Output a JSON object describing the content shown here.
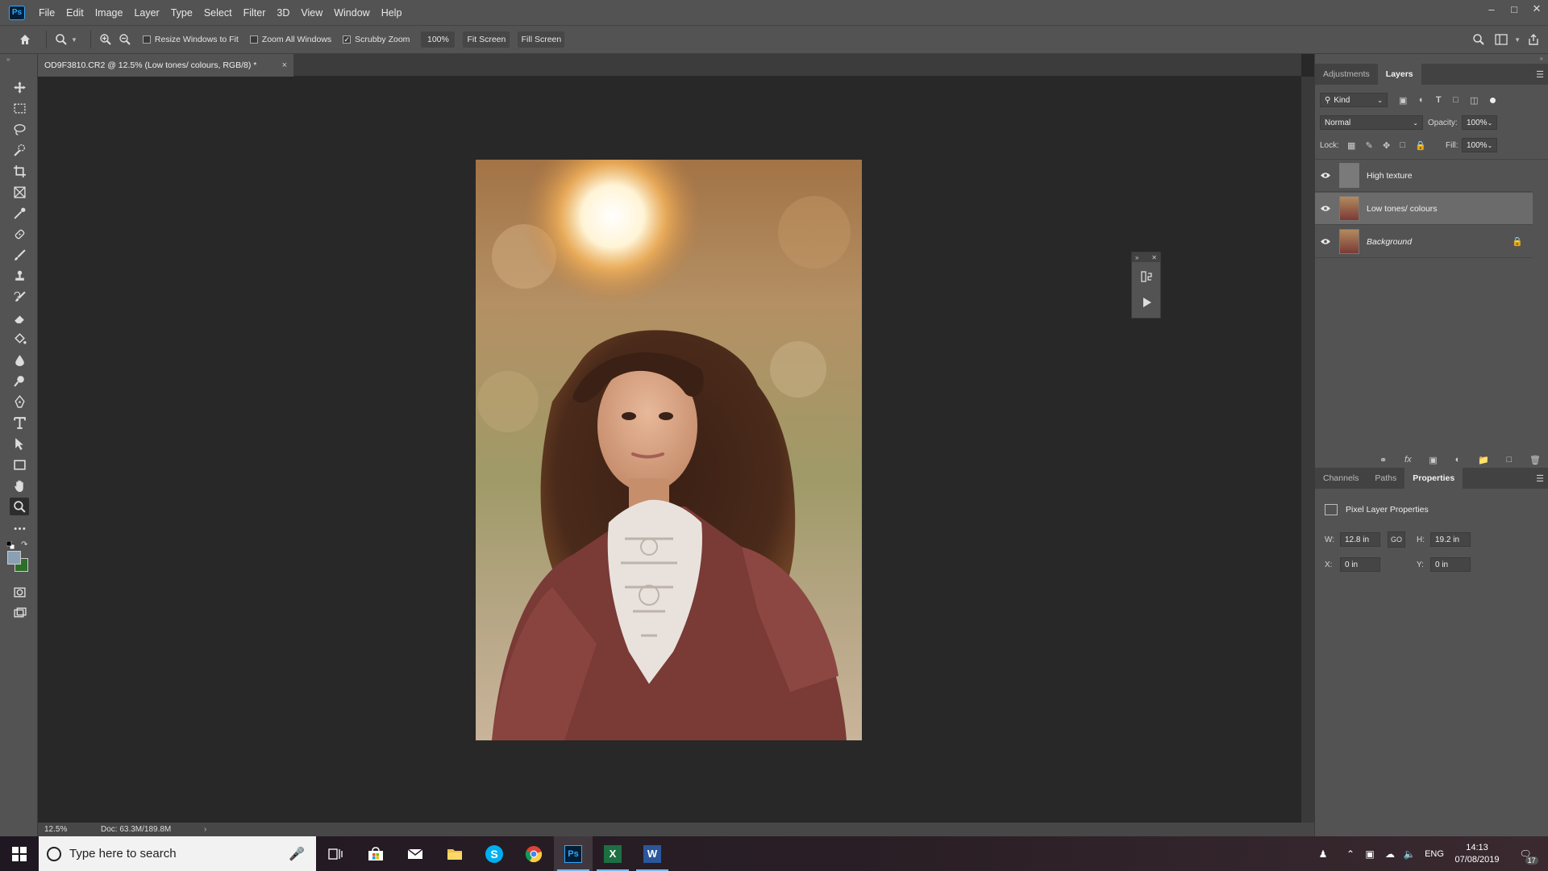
{
  "app": {
    "logo": "Ps"
  },
  "menu": [
    "File",
    "Edit",
    "Image",
    "Layer",
    "Type",
    "Select",
    "Filter",
    "3D",
    "View",
    "Window",
    "Help"
  ],
  "window_controls": [
    "minimize-icon",
    "restore-icon",
    "close-icon"
  ],
  "options": {
    "resize_windows": "Resize Windows to Fit",
    "zoom_all": "Zoom All Windows",
    "scrubby_zoom": "Scrubby Zoom",
    "zoom_value": "100%",
    "fit_screen": "Fit Screen",
    "fill_screen": "Fill Screen",
    "scrubby_checked": true
  },
  "document": {
    "tab_title": "OD9F3810.CR2 @ 12.5% (Low tones/ colours, RGB/8) *",
    "close": "×"
  },
  "status": {
    "zoom": "12.5%",
    "doc": "Doc: 63.3M/189.8M",
    "arrow": "›"
  },
  "layers_panel": {
    "tabs": [
      "Adjustments",
      "Layers"
    ],
    "active_tab": "Layers",
    "filter_kind": "Kind",
    "blend_mode": "Normal",
    "opacity_label": "Opacity:",
    "opacity": "100%",
    "lock_label": "Lock:",
    "fill_label": "Fill:",
    "fill": "100%",
    "layers": [
      {
        "name": "High texture",
        "selected": false
      },
      {
        "name": "Low tones/ colours",
        "selected": true
      },
      {
        "name": "Background",
        "selected": false,
        "locked": true
      }
    ]
  },
  "properties_panel": {
    "tabs": [
      "Channels",
      "Paths",
      "Properties"
    ],
    "active_tab": "Properties",
    "title": "Pixel Layer Properties",
    "w_label": "W:",
    "w": "12.8 in",
    "h_label": "H:",
    "h": "19.2 in",
    "x_label": "X:",
    "x": "0 in",
    "y_label": "Y:",
    "y": "0 in"
  },
  "taskbar": {
    "search_placeholder": "Type here to search",
    "lang": "ENG",
    "time": "14:13",
    "date": "07/08/2019",
    "notifications": "17"
  },
  "colors": {
    "accent": "#31a8ff",
    "panel": "#535353",
    "canvas": "#282828"
  }
}
